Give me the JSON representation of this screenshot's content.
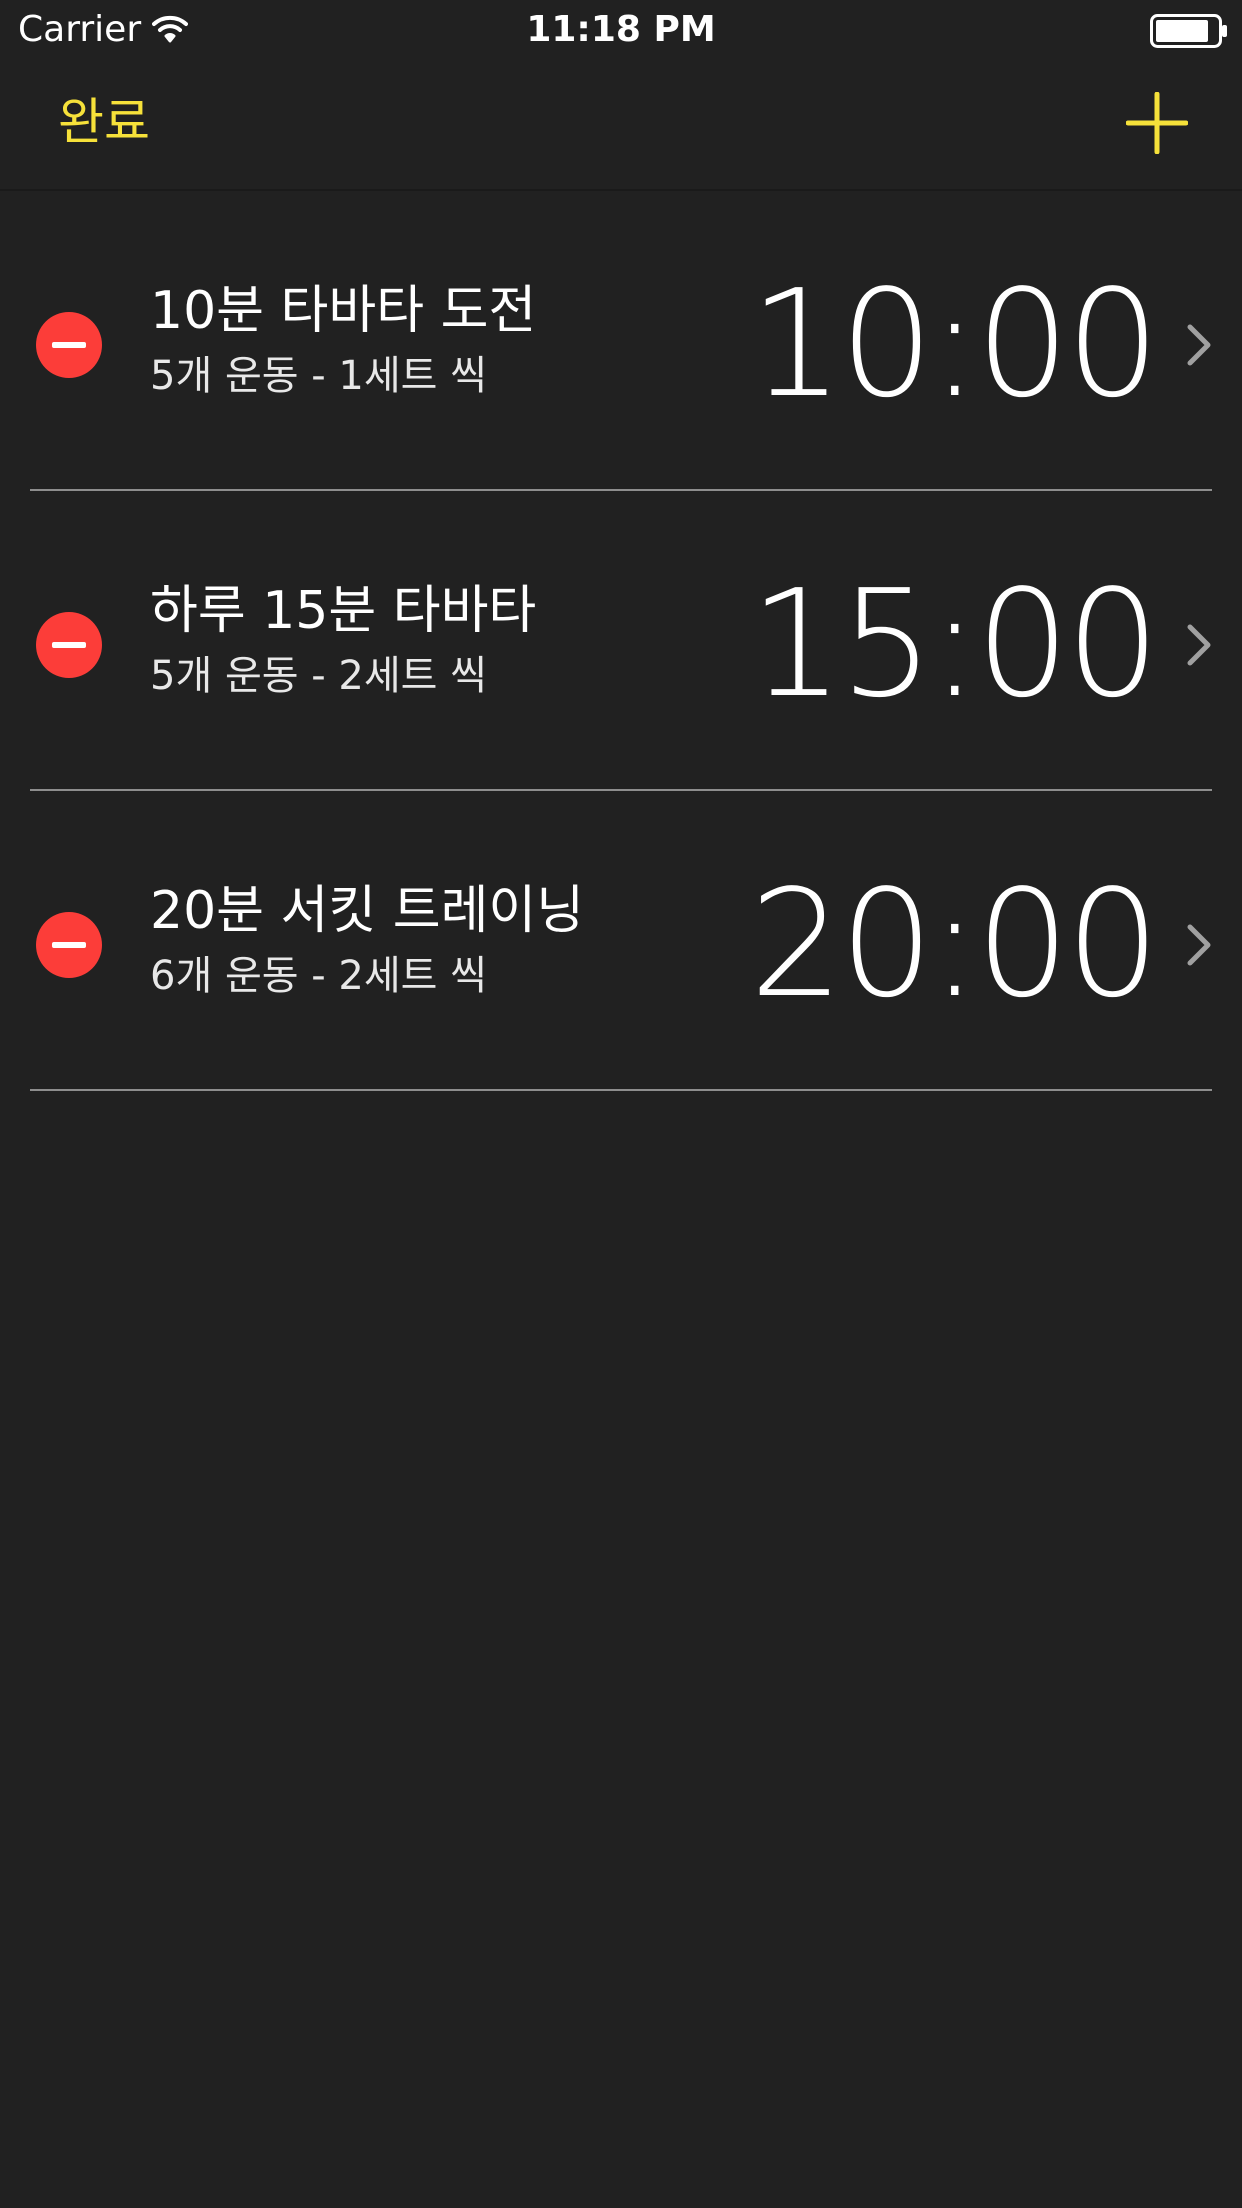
{
  "status_bar": {
    "carrier": "Carrier",
    "time": "11:18 PM",
    "wifi_icon": "wifi-icon",
    "battery_icon": "battery-icon"
  },
  "nav": {
    "done_label": "완료",
    "add_icon": "plus-icon",
    "accent_color": "#f6e13a"
  },
  "workouts": [
    {
      "title": "10분 타바타 도전",
      "subtitle": "5개 운동 - 1세트 씩",
      "duration": "10:00"
    },
    {
      "title": "하루 15분 타바타",
      "subtitle": "5개 운동 - 2세트 씩",
      "duration": "15:00"
    },
    {
      "title": "20분 서킷 트레이닝",
      "subtitle": "6개 운동 - 2세트 씩",
      "duration": "20:00"
    }
  ],
  "colors": {
    "background": "#212121",
    "delete": "#fc3d39",
    "divider": "#8e8e8e"
  }
}
